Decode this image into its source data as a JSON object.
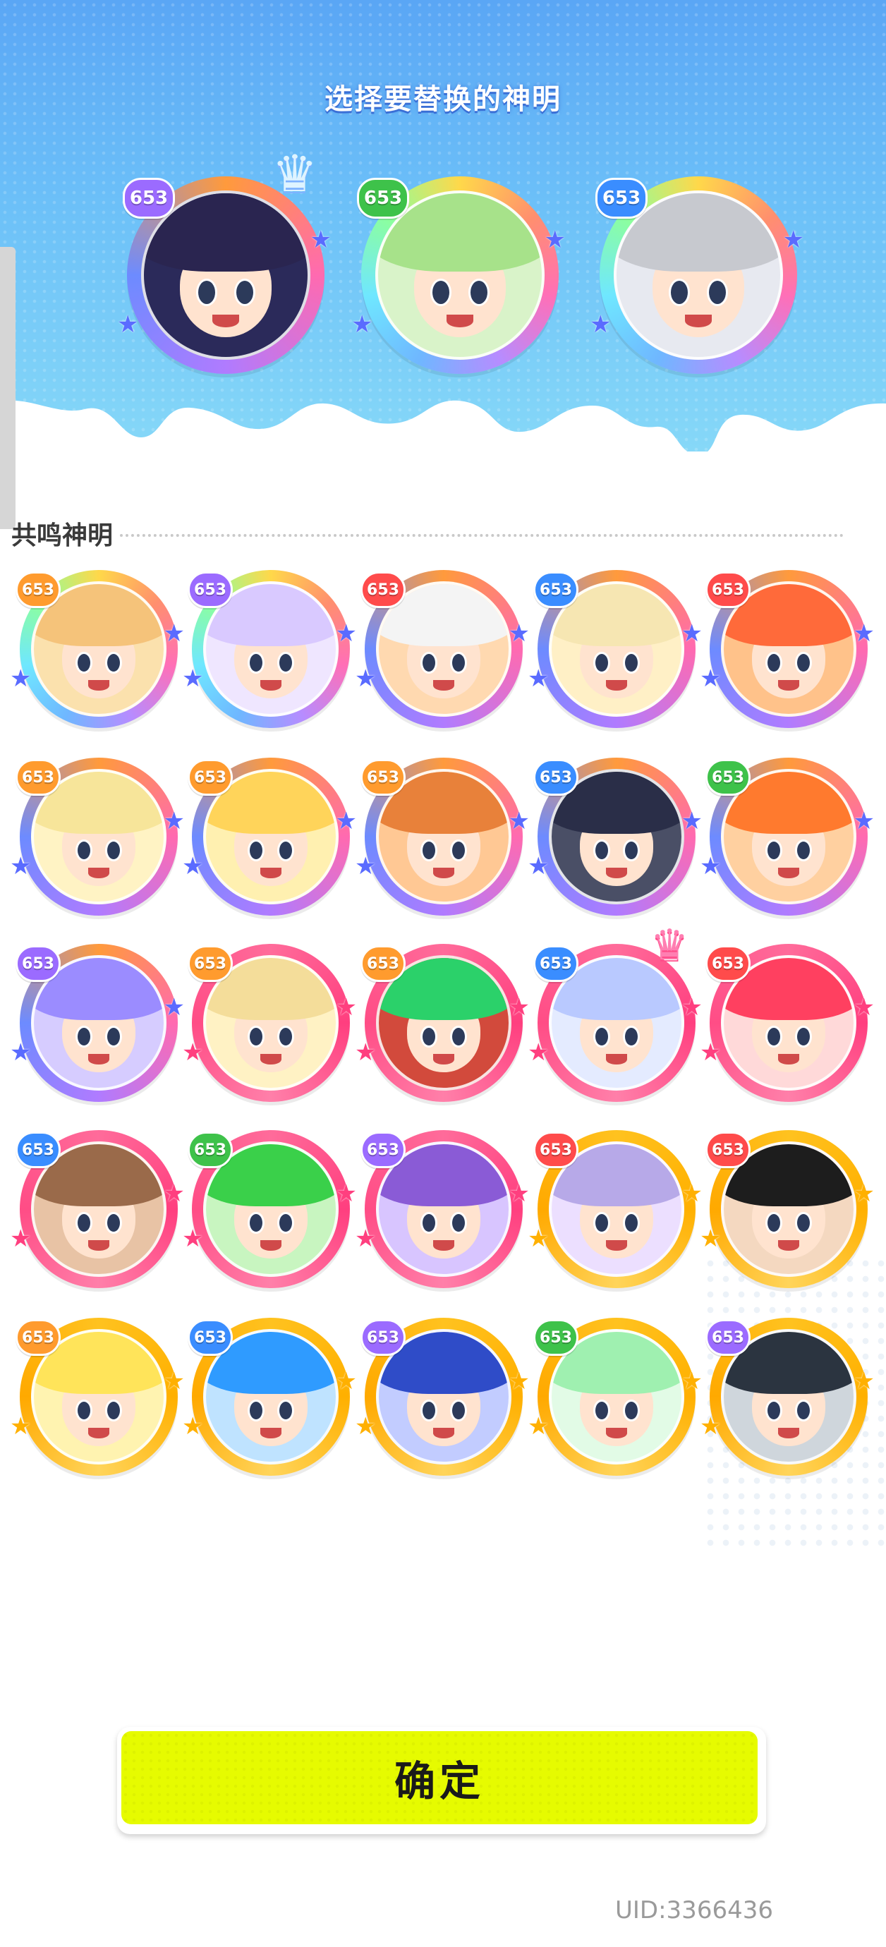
{
  "header": {
    "title": "选择要替换的神明"
  },
  "selected_gods": [
    {
      "level": "653",
      "ring": "violet",
      "level_color": "lv-purple",
      "hair": "#2a2550",
      "bg": "#2b2a5a",
      "crown": true
    },
    {
      "level": "653",
      "ring": "rainbow",
      "level_color": "lv-green",
      "hair": "#a7e28a",
      "bg": "#d9f3c9",
      "crown": false
    },
    {
      "level": "653",
      "ring": "rainbow",
      "level_color": "lv-blue",
      "hair": "#c7c9cf",
      "bg": "#e7e9f0",
      "crown": false
    }
  ],
  "resonance": {
    "title": "共鸣神明",
    "gods": [
      {
        "level": "653",
        "ring": "rainbow",
        "level_color": "lv-orange",
        "hair": "#f5c37a",
        "bg": "#fbe1ad"
      },
      {
        "level": "653",
        "ring": "rainbow",
        "level_color": "lv-purple",
        "hair": "#d9c9ff",
        "bg": "#efe6ff"
      },
      {
        "level": "653",
        "ring": "violet",
        "level_color": "lv-red",
        "hair": "#f4f4f4",
        "bg": "#ffd9b0"
      },
      {
        "level": "653",
        "ring": "violet",
        "level_color": "lv-blue",
        "hair": "#f6e6b2",
        "bg": "#fff0c6"
      },
      {
        "level": "653",
        "ring": "violet",
        "level_color": "lv-red",
        "hair": "#ff6a3a",
        "bg": "#ffc28a"
      },
      {
        "level": "653",
        "ring": "violet",
        "level_color": "lv-orange",
        "hair": "#f7e59a",
        "bg": "#fff3c4"
      },
      {
        "level": "653",
        "ring": "violet",
        "level_color": "lv-orange",
        "hair": "#ffd45a",
        "bg": "#fff0b0"
      },
      {
        "level": "653",
        "ring": "violet",
        "level_color": "lv-orange",
        "hair": "#e8813a",
        "bg": "#ffc894"
      },
      {
        "level": "653",
        "ring": "violet",
        "level_color": "lv-blue",
        "hair": "#2a2e48",
        "bg": "#4a4f66"
      },
      {
        "level": "653",
        "ring": "violet",
        "level_color": "lv-green",
        "hair": "#ff7a2e",
        "bg": "#ffd0a0"
      },
      {
        "level": "653",
        "ring": "violet",
        "level_color": "lv-purple",
        "hair": "#9b8cff",
        "bg": "#d6ccff"
      },
      {
        "level": "653",
        "ring": "pink",
        "level_color": "lv-orange",
        "hair": "#f4dd9a",
        "bg": "#fff2c4"
      },
      {
        "level": "653",
        "ring": "pink",
        "level_color": "lv-orange",
        "hair": "#2bd16a",
        "bg": "#d24a3c"
      },
      {
        "level": "653",
        "ring": "pink",
        "level_color": "lv-blue",
        "hair": "#b9c9ff",
        "bg": "#e4ebff",
        "crown": true
      },
      {
        "level": "653",
        "ring": "pink",
        "level_color": "lv-red",
        "hair": "#ff4060",
        "bg": "#ffd9d9"
      },
      {
        "level": "653",
        "ring": "pink",
        "level_color": "lv-blue",
        "hair": "#9a6a4a",
        "bg": "#e8c3a5"
      },
      {
        "level": "653",
        "ring": "pink",
        "level_color": "lv-green",
        "hair": "#3ad04a",
        "bg": "#c8f5c0"
      },
      {
        "level": "653",
        "ring": "pink",
        "level_color": "lv-purple",
        "hair": "#8a5bd6",
        "bg": "#d8c5ff"
      },
      {
        "level": "653",
        "ring": "gold",
        "level_color": "lv-red",
        "hair": "#b7a9e8",
        "bg": "#ecdfff"
      },
      {
        "level": "653",
        "ring": "gold",
        "level_color": "lv-red",
        "hair": "#1d1d1d",
        "bg": "#f4d8c0"
      },
      {
        "level": "653",
        "ring": "gold",
        "level_color": "lv-orange",
        "hair": "#ffe45a",
        "bg": "#fff3b0"
      },
      {
        "level": "653",
        "ring": "gold",
        "level_color": "lv-blue",
        "hair": "#2f9bff",
        "bg": "#bfe3ff"
      },
      {
        "level": "653",
        "ring": "gold",
        "level_color": "lv-purple",
        "hair": "#2f4cc8",
        "bg": "#c2ccff"
      },
      {
        "level": "653",
        "ring": "gold",
        "level_color": "lv-green",
        "hair": "#9ff0b0",
        "bg": "#e2fbe6"
      },
      {
        "level": "653",
        "ring": "gold",
        "level_color": "lv-purple",
        "hair": "#2b3440",
        "bg": "#cfd6dc"
      }
    ]
  },
  "footer": {
    "confirm_label": "确定",
    "uid": "UID:3366436"
  }
}
